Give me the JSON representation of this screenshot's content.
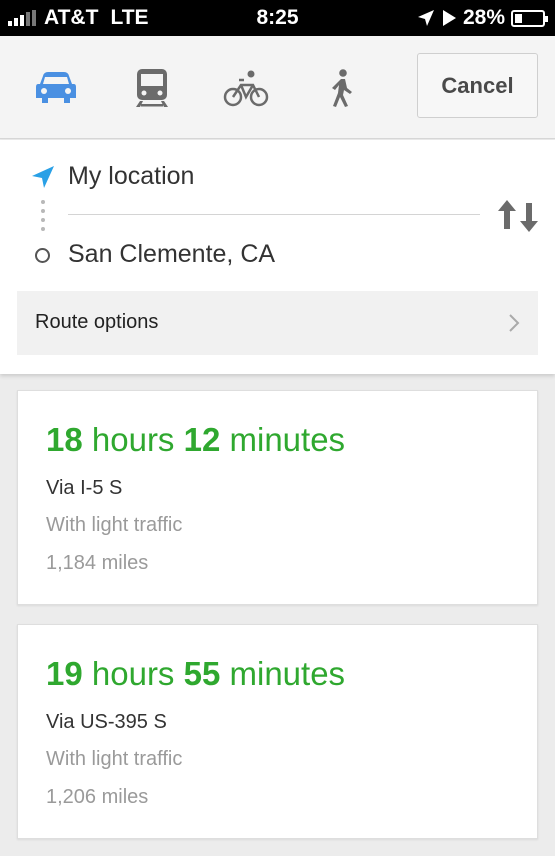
{
  "status_bar": {
    "carrier": "AT&T",
    "network": "LTE",
    "time": "8:25",
    "battery": "28%",
    "battery_level": 0.28
  },
  "modes": [
    {
      "name": "driving",
      "icon": "car-icon",
      "selected": true
    },
    {
      "name": "transit",
      "icon": "train-icon",
      "selected": false
    },
    {
      "name": "cycling",
      "icon": "bicycle-icon",
      "selected": false
    },
    {
      "name": "walking",
      "icon": "walking-icon",
      "selected": false
    }
  ],
  "cancel_label": "Cancel",
  "origin": {
    "text": "My location",
    "icon": "location-arrow-icon"
  },
  "destination": {
    "text": "San Clemente, CA",
    "icon": "destination-circle-icon"
  },
  "swap_icon": "swap-arrows-icon",
  "route_options_label": "Route options",
  "routes": [
    {
      "hours": "18",
      "hours_unit": " hours ",
      "minutes": "12",
      "minutes_unit": " minutes",
      "via": "Via I-5 S",
      "traffic": "With light traffic",
      "distance": "1,184 miles"
    },
    {
      "hours": "19",
      "hours_unit": " hours ",
      "minutes": "55",
      "minutes_unit": " minutes",
      "via": "Via US-395 S",
      "traffic": "With light traffic",
      "distance": "1,206 miles"
    }
  ],
  "colors": {
    "accent_blue": "#4a90e2",
    "duration_green": "#2fa82f",
    "icon_gray": "#6b6b6b"
  }
}
